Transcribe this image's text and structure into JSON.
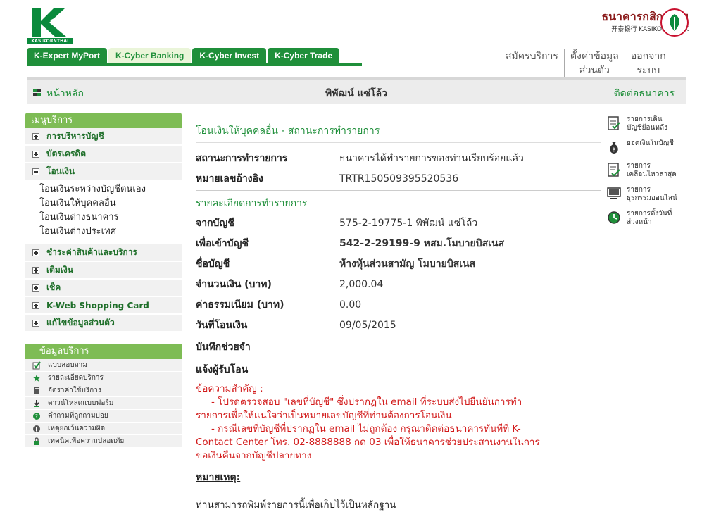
{
  "brand": {
    "logo_text": "KASIKORNTHAI",
    "bank_name_th": "ธนาคารกสิกรไทย",
    "bank_name_en": "开泰银行 KASIKORNBANK"
  },
  "top_tabs": [
    {
      "label": "K-Expert MyPort"
    },
    {
      "label": "K-Cyber Banking"
    },
    {
      "label": "K-Cyber Invest"
    },
    {
      "label": "K-Cyber Trade"
    }
  ],
  "top_links": [
    {
      "line1": "สมัครบริการ",
      "line2": ""
    },
    {
      "line1": "ตั้งค่าข้อมูล",
      "line2": "ส่วนตัว"
    },
    {
      "line1": "ออกจาก",
      "line2": "ระบบ"
    }
  ],
  "breadcrumb": {
    "home": "หน้าหลัก",
    "user_name": "พิพัฒน์ แซ่โล้ว",
    "contact": "ติดต่อธนาคาร"
  },
  "menu": {
    "title": "เมนูบริการ",
    "items": [
      {
        "label": "การบริหารบัญชี"
      },
      {
        "label": "บัตรเครดิต"
      },
      {
        "label": "โอนเงิน"
      },
      {
        "label": "ชำระค่าสินค้าและบริการ"
      },
      {
        "label": "เติมเงิน"
      },
      {
        "label": "เช็ค"
      },
      {
        "label": "K-Web Shopping Card"
      },
      {
        "label": "แก้ไขข้อมูลส่วนตัว"
      }
    ],
    "submenu": [
      "โอนเงินระหว่างบัญชีตนเอง",
      "โอนเงินให้บุคคลอื่น",
      "โอนเงินต่างธนาคาร",
      "โอนเงินต่างประเทศ"
    ]
  },
  "info_menu": {
    "title": "ข้อมูลบริการ",
    "items": [
      "แบบสอบถาม",
      "รายละเอียดบริการ",
      "อัตราค่าใช้บริการ",
      "ดาวน์โหลดแบบฟอร์ม",
      "คำถามที่ถูกถามบ่อย",
      "เหตุยกเว้นความผิด",
      "เทคนิคเพื่อความปลอดภัย"
    ]
  },
  "main": {
    "title": "โอนเงินให้บุคคลอื่น - สถานะการทำรายการ",
    "status_label": "สถานะการทำรายการ",
    "status_value": "ธนาคารได้ทำรายการของท่านเรียบร้อยแล้ว",
    "ref_label": "หมายเลขอ้างอิง",
    "ref_value": "TRTR150509395520536",
    "details_title": "รายละเอียดการทำรายการ",
    "from_label": "จากบัญชี",
    "from_value": "575-2-19775-1 พิพัฒน์ แซ่โล้ว",
    "to_label": "เพื่อเข้าบัญชี",
    "to_value": "542-2-29199-9 หสม.โมบายบิสเนส",
    "acct_name_label": "ชื่อบัญชี",
    "acct_name_value": "ห้างหุ้นส่วนสามัญ โมบายบิสเนส",
    "amount_label": "จำนวนเงิน (บาท)",
    "amount_value": "2,000.04",
    "fee_label": "ค่าธรรมเนียม (บาท)",
    "fee_value": "0.00",
    "date_label": "วันที่โอนเงิน",
    "date_value": "09/05/2015",
    "memo_label": "บันทึกช่วยจำ",
    "notify_label": "แจ้งผู้รับโอน",
    "notice_title": "ข้อความสำคัญ :",
    "notice_1a": "- โปรดตรวจสอบ \"เลขที่บัญชี\" ซึ่งปรากฏใน email ที่ระบบส่งไปยืนยันการทำ",
    "notice_1b": "รายการเพื่อให้แน่ใจว่าเป็นหมายเลขบัญชีที่ท่านต้องการโอนเงิน",
    "notice_2a": "- กรณีเลขที่บัญชีที่ปรากฏใน email ไม่ถูกต้อง กรุณาติดต่อธนาคารทันทีที่ K-",
    "notice_2b": "Contact Center โทร. 02-8888888 กด 03 เพื่อให้ธนาคารช่วยประสานงานในการ",
    "notice_2c": "ขอเงินคืนจากบัญชีปลายทาง",
    "remark_title": "หมายเหตุ:",
    "remark_text": "ท่านสามารถพิมพ์รายการนี้เพื่อเก็บไว้เป็นหลักฐาน"
  },
  "side_links": [
    {
      "line1": "รายการเดิน",
      "line2": "บัญชีย้อนหลัง"
    },
    {
      "line1": "ยอดเงินในบัญชี",
      "line2": ""
    },
    {
      "line1": "รายการ",
      "line2": "เคลื่อนไหวล่าสุด"
    },
    {
      "line1": "รายการ",
      "line2": "ธุรกรรมออนไลน์"
    },
    {
      "line1": "รายการตั้งวันที่",
      "line2": "ล่วงหน้า"
    }
  ],
  "colors": {
    "brand_green": "#1f8f3a",
    "menu_green": "#7ebc55",
    "notice_red": "#d21b1b"
  }
}
